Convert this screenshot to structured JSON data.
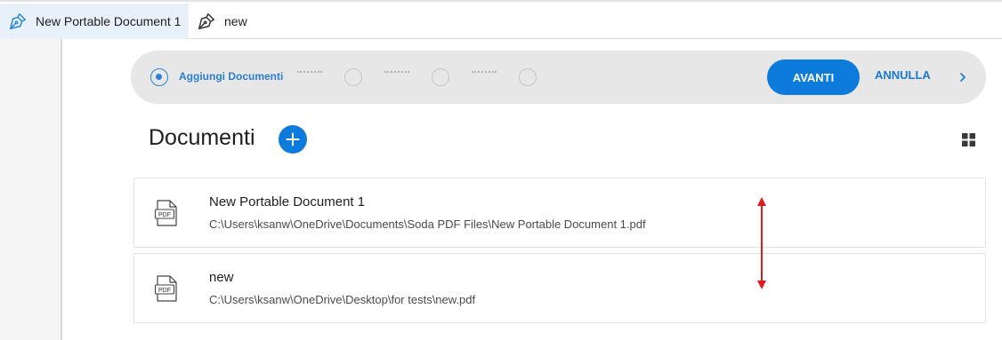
{
  "tabs": [
    {
      "label": "New Portable Document 1",
      "icon": "pen-nib-icon",
      "active": true
    },
    {
      "label": "new",
      "icon": "pen-nib-icon",
      "active": false
    }
  ],
  "wizard": {
    "steps": [
      {
        "label": "Aggiungi Documenti",
        "active": true
      },
      {
        "label": "",
        "active": false
      },
      {
        "label": "",
        "active": false
      },
      {
        "label": "",
        "active": false
      }
    ],
    "next_label": "AVANTI",
    "cancel_label": "ANNULLA"
  },
  "documents_section": {
    "title": "Documenti",
    "add_icon": "plus-icon",
    "view_toggle_icon": "grid-view-icon"
  },
  "documents": [
    {
      "name": "New Portable Document 1",
      "path": "C:\\Users\\ksanw\\OneDrive\\Documents\\Soda PDF Files\\New Portable Document 1.pdf",
      "icon_text": "PDF"
    },
    {
      "name": "new",
      "path": "C:\\Users\\ksanw\\OneDrive\\Desktop\\for tests\\new.pdf",
      "icon_text": "PDF"
    }
  ],
  "colors": {
    "accent": "#0d7bdc",
    "active_tab_bg": "#e8f1fa",
    "wizard_bg": "#e7e7e7",
    "annotation_arrow": "#e01b1b"
  }
}
